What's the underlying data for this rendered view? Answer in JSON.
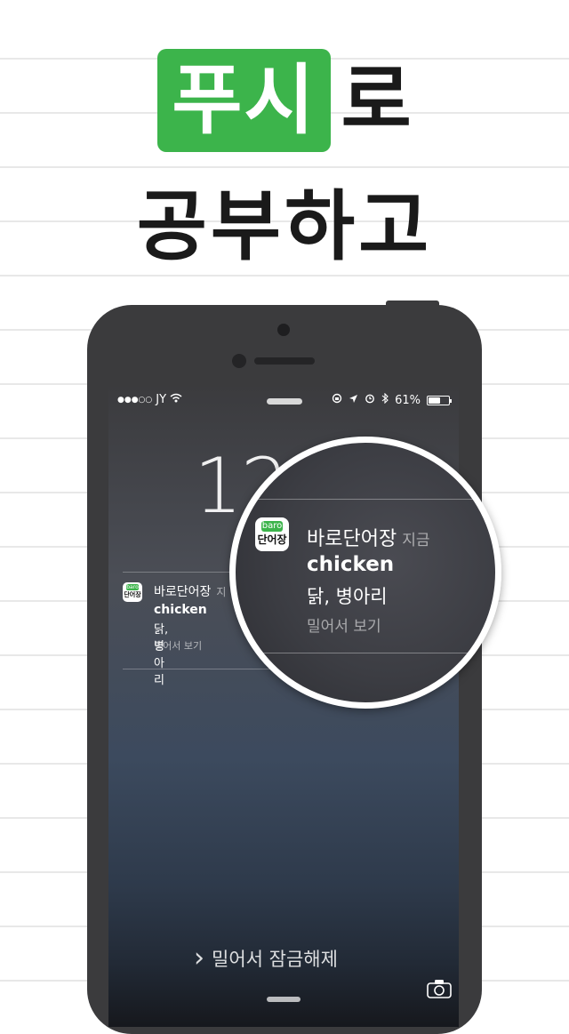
{
  "headline": {
    "highlight_text": "푸시",
    "line1_tail": "로",
    "line2": "공부하고"
  },
  "colors": {
    "accent_green": "#3cb44b",
    "phone_body": "#3b3b3d"
  },
  "status_bar": {
    "signal": "●●●○○",
    "carrier": "JY",
    "battery_percent": "61%",
    "battery_level": 0.61,
    "icons": [
      "wifi-icon",
      "orientation-lock-icon",
      "location-icon",
      "alarm-icon",
      "bluetooth-icon",
      "battery-icon"
    ]
  },
  "lock_screen": {
    "clock_partial": "12",
    "slide_to_unlock": "밀어서 잠금해제",
    "chevron": "›"
  },
  "notification": {
    "app_icon_top": "baro",
    "app_icon_bottom": "단어장",
    "app_name": "바로단어장",
    "time_partial": "지",
    "word": "chicken",
    "meaning": "닭, 병아리",
    "action": "밀어서 보기"
  },
  "magnified_notification": {
    "app_icon_top": "baro",
    "app_icon_bottom": "단어장",
    "app_name": "바로단어장",
    "time": "지금",
    "word": "chicken",
    "meaning": "닭, 병아리",
    "action": "밀어서 보기"
  }
}
